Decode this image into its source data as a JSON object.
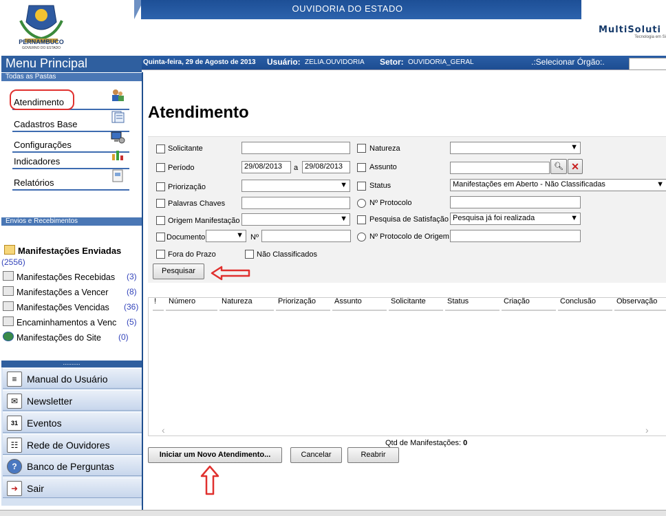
{
  "header": {
    "title": "OUVIDORIA DO ESTADO",
    "state_name": "PERNAMBUCO",
    "state_sub": "GOVERNO DO ESTADO",
    "brand": "MultiSoluti",
    "brand_tagline": "Tecnologia em Si"
  },
  "info_bar": {
    "date": "Quinta-feira, 29 de Agosto de 2013",
    "user_label": "Usuário:",
    "user_value": "ZELIA.OUVIDORIA",
    "sector_label": "Setor:",
    "sector_value": "OUVIDORIA_GERAL",
    "org_label": ".:Selecionar Órgão:."
  },
  "sidebar": {
    "menu_title": "Menu Principal",
    "folders_header": "Todas as Pastas",
    "folders": [
      {
        "label": "Atendimento",
        "icon": "people-icon"
      },
      {
        "label": "Cadastros Base",
        "icon": "documents-icon"
      },
      {
        "label": "Configurações",
        "icon": "computer-icon"
      },
      {
        "label": "Indicadores",
        "icon": "bar-chart-icon"
      },
      {
        "label": "Relatórios",
        "icon": "report-icon"
      }
    ],
    "envios_header": "Envios e Recebimentos",
    "enviadas": {
      "label": "Manifestações Enviadas",
      "count": "(2556)"
    },
    "envios": [
      {
        "label": "Manifestações Recebidas",
        "count": "(3)"
      },
      {
        "label": "Manifestações a Vencer",
        "count": "(8)"
      },
      {
        "label": "Manifestações Vencidas",
        "count": "(36)"
      },
      {
        "label": "Encaminhamentos a Venc",
        "count": "(5)"
      },
      {
        "label": "Manifestações do Site",
        "count": "(0)"
      }
    ],
    "divider": "..........",
    "buttons": [
      {
        "label": "Manual do Usuário",
        "icon": "manual-icon"
      },
      {
        "label": "Newsletter",
        "icon": "newsletter-icon"
      },
      {
        "label": "Eventos",
        "icon": "calendar-icon"
      },
      {
        "label": "Rede de Ouvidores",
        "icon": "network-icon"
      },
      {
        "label": "Banco de Perguntas",
        "icon": "question-icon"
      },
      {
        "label": "Sair",
        "icon": "exit-icon"
      }
    ],
    "calendar_day": "31"
  },
  "main": {
    "title": "Atendimento",
    "filters": {
      "solicitante": "Solicitante",
      "periodo": "Período",
      "periodo_start": "29/08/2013",
      "periodo_sep": "a",
      "periodo_end": "29/08/2013",
      "priorizacao": "Priorização",
      "palavras_chaves": "Palavras Chaves",
      "origem": "Origem Manifestação",
      "documento": "Documento",
      "numero": "Nº",
      "fora_prazo": "Fora do Prazo",
      "nao_classificados": "Não Classificados",
      "natureza": "Natureza",
      "assunto": "Assunto",
      "status": "Status",
      "status_value": "Manifestações em Aberto - Não Classificadas",
      "protocolo": "Nº Protocolo",
      "pesquisa": "Pesquisa de Satisfação",
      "pesquisa_value": "Pesquisa já foi realizada",
      "protocolo_origem": "Nº Protocolo de Origem"
    },
    "search_button": "Pesquisar",
    "grid_columns": [
      "!",
      "Número",
      "Natureza",
      "Priorização",
      "Assunto",
      "Solicitante",
      "Status",
      "Criação",
      "Conclusão",
      "Observação"
    ],
    "qtd_label": "Qtd de Manifestações:",
    "qtd_value": "0",
    "buttons": {
      "new": "Iniciar um Novo Atendimento...",
      "cancel": "Cancelar",
      "reopen": "Reabrir"
    }
  },
  "colors": {
    "header_blue": "#1d4f96",
    "annotation_red": "#e0302e"
  }
}
